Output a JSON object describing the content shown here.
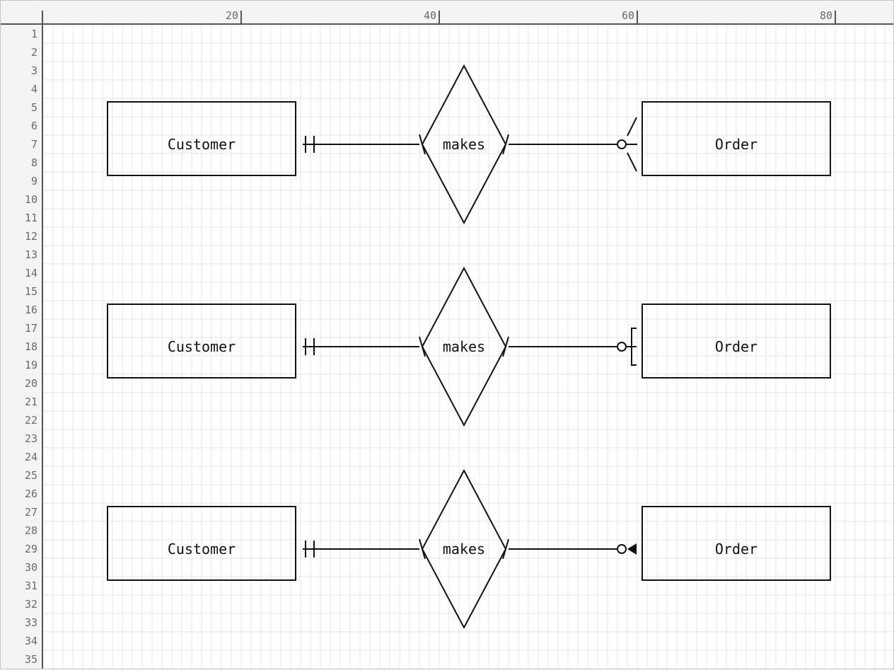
{
  "ruler": {
    "column_labels": [
      "20",
      "40",
      "60",
      "80"
    ],
    "column_values": [
      20,
      40,
      60,
      80
    ],
    "row_labels": [
      "1",
      "2",
      "3",
      "4",
      "5",
      "6",
      "7",
      "8",
      "9",
      "10",
      "11",
      "12",
      "13",
      "14",
      "15",
      "16",
      "17",
      "18",
      "19",
      "20",
      "21",
      "22",
      "23",
      "24",
      "25",
      "26",
      "27",
      "28",
      "29",
      "30",
      "31",
      "32",
      "33",
      "34",
      "35"
    ]
  },
  "diagrams": [
    {
      "left_entity": "Customer",
      "relationship": "makes",
      "right_entity": "Order",
      "left_cardinality": "exactly-one",
      "right_cardinality": "zero-or-many",
      "right_marker_icon": "crows-foot"
    },
    {
      "left_entity": "Customer",
      "relationship": "makes",
      "right_entity": "Order",
      "left_cardinality": "exactly-one",
      "right_cardinality": "zero-or-one",
      "right_marker_icon": "bracket"
    },
    {
      "left_entity": "Customer",
      "relationship": "makes",
      "right_entity": "Order",
      "left_cardinality": "exactly-one",
      "right_cardinality": "zero-or-one-arrow",
      "right_marker_icon": "arrowhead"
    }
  ],
  "colors": {
    "ink": "#111111",
    "grid": "#e6e6e6",
    "ruler_bg": "#f4f4f4",
    "ruler_text": "#6b6b6b",
    "ruler_line": "#555555"
  }
}
